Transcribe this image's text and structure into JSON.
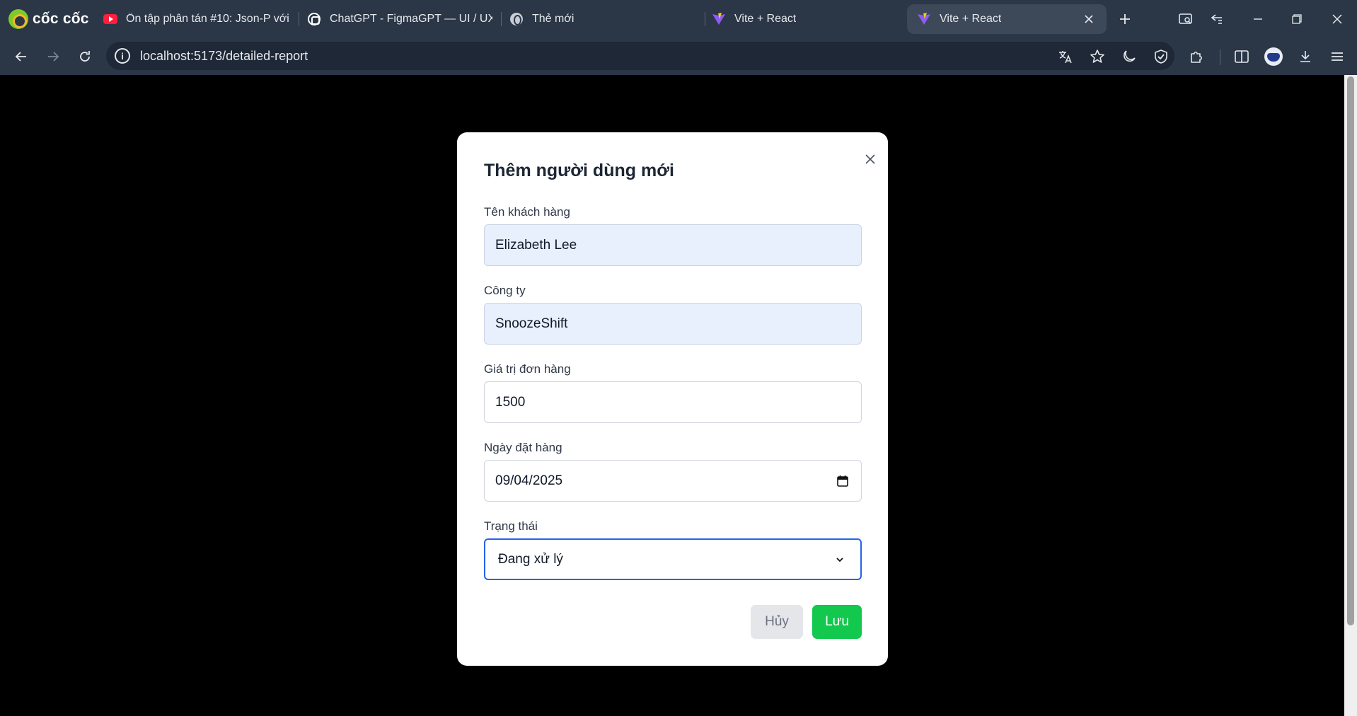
{
  "browser": {
    "brand": "cốc cốc",
    "tabs": [
      {
        "title": "Ôn tập phân tán #10: Json-P với",
        "icon": "youtube-icon"
      },
      {
        "title": "ChatGPT - FigmaGPT — UI / UX",
        "icon": "chatgpt-icon"
      },
      {
        "title": "Thẻ mới",
        "icon": "globe-icon"
      },
      {
        "title": "Vite + React",
        "icon": "vite-icon"
      },
      {
        "title": "Vite + React",
        "icon": "vite-icon",
        "active": true
      }
    ],
    "url": "localhost:5173/detailed-report"
  },
  "modal": {
    "title": "Thêm người dùng mới",
    "fields": {
      "customer_name": {
        "label": "Tên khách hàng",
        "value": "Elizabeth Lee"
      },
      "company": {
        "label": "Công ty",
        "value": "SnoozeShift"
      },
      "order_value": {
        "label": "Giá trị đơn hàng",
        "value": "1500"
      },
      "order_date": {
        "label": "Ngày đặt hàng",
        "value": "09/04/2025"
      },
      "status": {
        "label": "Trạng thái",
        "value": "Đang xử lý"
      }
    },
    "buttons": {
      "cancel": "Hủy",
      "save": "Lưu"
    }
  },
  "colors": {
    "save_button": "#12c84d",
    "focus_border": "#2563eb",
    "autofill_background": "#e8f0fe",
    "chrome_background": "#2b3646"
  }
}
